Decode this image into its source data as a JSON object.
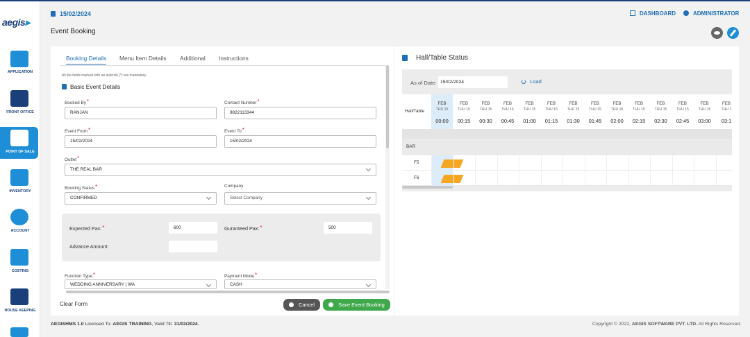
{
  "app": {
    "logo": "aegis"
  },
  "sidebar": {
    "items": [
      {
        "label": "APPLICATION",
        "icon": "gear-screen-icon"
      },
      {
        "label": "FRONT OFFICE",
        "icon": "front-desk-icon"
      },
      {
        "label": "POINT OF SALE",
        "icon": "pos-terminal-icon",
        "active": true
      },
      {
        "label": "INVENTORY",
        "icon": "warehouse-icon"
      },
      {
        "label": "ACCOUNT",
        "icon": "money-bag-icon"
      },
      {
        "label": "COSTING",
        "icon": "calculator-icon"
      },
      {
        "label": "HOUSE KEEPING",
        "icon": "cleaner-icon"
      }
    ]
  },
  "header": {
    "date": "15/02/2024",
    "page_title": "Event Booking",
    "dashboard": "DASHBOARD",
    "admin": "ADMINISTRATOR"
  },
  "form": {
    "tabs": [
      "Booking Details",
      "Menu Item Details",
      "Additional",
      "Instructions"
    ],
    "mandatory_note": "All the fields marked with an asterisk (*) are mandatory.",
    "section_title": "Basic Event Details",
    "booked_by": {
      "label": "Booked By",
      "value": "RANJAN"
    },
    "contact": {
      "label": "Contact Number",
      "value": "9822113344"
    },
    "event_from": {
      "label": "Event From",
      "value": "15/02/2024"
    },
    "event_to": {
      "label": "Event To",
      "value": "15/02/2024"
    },
    "outlet": {
      "label": "Outlet",
      "value": "THE REAL BAR"
    },
    "booking_status": {
      "label": "Booking Status",
      "value": "CONFIRMED"
    },
    "company": {
      "label": "Company",
      "value": "Select Company"
    },
    "expected_pax": {
      "label": "Expected Pax:",
      "value": "600"
    },
    "guaranteed_pax": {
      "label": "Guranteed Pax:",
      "value": "500"
    },
    "advance_amount": {
      "label": "Advance Amount:",
      "value": ""
    },
    "function_type": {
      "label": "Function Type",
      "value": "WEDDING ANNIVERSARY | WA"
    },
    "payment_mode": {
      "label": "Payment Mode",
      "value": "CASH"
    },
    "clear_label": "Clear Form",
    "cancel_label": "Cancel",
    "save_label": "Save Event Booking"
  },
  "status": {
    "title": "Hall/Table Status",
    "as_of_label": "As of Date:",
    "as_of_value": "15/02/2024",
    "load_label": "Load",
    "hall_table_header": "Hall/Table",
    "times": [
      {
        "m": "FEB",
        "d": "THU 15",
        "t": "00:00"
      },
      {
        "m": "FEB",
        "d": "THU 15",
        "t": "00:15"
      },
      {
        "m": "FEB",
        "d": "THU 15",
        "t": "00:30"
      },
      {
        "m": "FEB",
        "d": "THU 15",
        "t": "00:45"
      },
      {
        "m": "FEB",
        "d": "THU 15",
        "t": "01:00"
      },
      {
        "m": "FEB",
        "d": "THU 15",
        "t": "01:15"
      },
      {
        "m": "FEB",
        "d": "THU 15",
        "t": "01:30"
      },
      {
        "m": "FEB",
        "d": "THU 15",
        "t": "01:45"
      },
      {
        "m": "FEB",
        "d": "THU 15",
        "t": "02:00"
      },
      {
        "m": "FEB",
        "d": "THU 15",
        "t": "02:15"
      },
      {
        "m": "FEB",
        "d": "THU 15",
        "t": "02:30"
      },
      {
        "m": "FEB",
        "d": "THU 15",
        "t": "02:45"
      },
      {
        "m": "FEB",
        "d": "THU 15",
        "t": "03:00"
      },
      {
        "m": "FEB",
        "d": "THU 1",
        "t": "03:1"
      }
    ],
    "group": "BAR",
    "rows": [
      "F5",
      "F6"
    ],
    "booking_color": "#f5a623"
  },
  "footer": {
    "product": "AEGISHMS 1.0",
    "licensed_to_label": "Licensed To:",
    "licensed_to": "AEGIS TRAINING",
    "valid_till_label": ", Valid Till:",
    "valid_till": "31/03/2024.",
    "copyright_prefix": "Copyright © 2022,",
    "company": "AEGIS SOFTWARE PVT. LTD.",
    "rights": "All Rights Reserved."
  },
  "colors": {
    "accent": "#1e6fb5",
    "active_nav": "#1e8ed6",
    "save": "#3fa84b",
    "cancel": "#555555"
  }
}
